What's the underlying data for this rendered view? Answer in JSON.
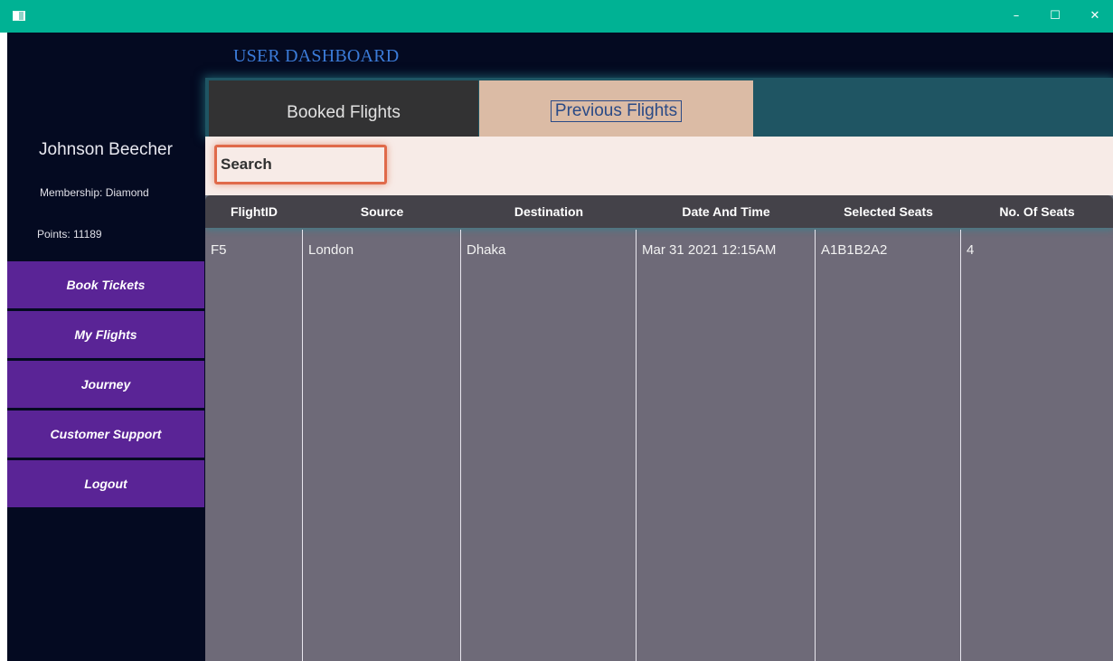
{
  "window": {
    "minimize": "–",
    "maximize": "☐",
    "close": "✕",
    "icon": "app-window-icon",
    "titlebar_color": "#00b294"
  },
  "dashboard": {
    "title": "USER DASHBOARD"
  },
  "user": {
    "name": "Johnson Beecher",
    "membership": "Membership: Diamond",
    "points": "Points: 11189"
  },
  "nav": {
    "items": [
      {
        "label": "Book Tickets"
      },
      {
        "label": "My Flights"
      },
      {
        "label": "Journey"
      },
      {
        "label": "Customer Support"
      },
      {
        "label": "Logout"
      }
    ]
  },
  "tabs": [
    {
      "label": "Booked Flights"
    },
    {
      "label": "Previous Flights",
      "selected": true
    }
  ],
  "search": {
    "placeholder": "Search",
    "value": ""
  },
  "table": {
    "columns": [
      "FlightID",
      "Source",
      "Destination",
      "Date And Time",
      "Selected Seats",
      "No. Of Seats"
    ],
    "rows": [
      [
        "F5",
        "London",
        "Dhaka",
        "Mar 31 2021 12:15AM",
        "A1B1B2A2",
        "4"
      ]
    ]
  },
  "colors": {
    "background": "#040a21",
    "nav_button": "#5a2496",
    "title": "#3b7bd8",
    "selected_tab": "#dbbba5",
    "unselected_tab": "#323233",
    "search_border": "#e06a4a",
    "grid_body": "#6e6a78",
    "grid_header": "#444249"
  }
}
